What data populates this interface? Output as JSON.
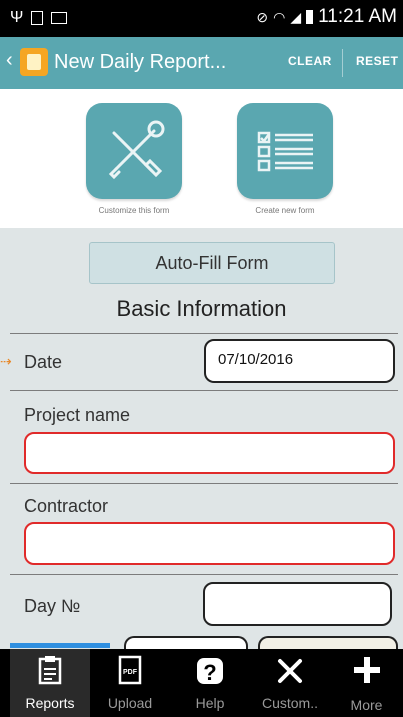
{
  "status": {
    "time": "11:21 AM"
  },
  "action_bar": {
    "title": "New Daily Report...",
    "clear": "CLEAR",
    "reset": "RESET"
  },
  "tiles": [
    {
      "caption": "Customize this form",
      "icon": "wrench-screwdriver-icon"
    },
    {
      "caption": "Create new form",
      "icon": "checklist-icon"
    }
  ],
  "autofill": {
    "label": "Auto-Fill Form"
  },
  "section": {
    "title": "Basic Information"
  },
  "fields": {
    "date": {
      "label": "Date",
      "value": "07/10/2016"
    },
    "project_name": {
      "label": "Project name",
      "value": ""
    },
    "contractor": {
      "label": "Contractor",
      "value": ""
    },
    "day_no": {
      "label": "Day №",
      "value": ""
    }
  },
  "tabs": [
    {
      "label": "Reports",
      "icon": "clipboard-icon",
      "active": true
    },
    {
      "label": "Upload",
      "icon": "pdf-icon",
      "active": false
    },
    {
      "label": "Help",
      "icon": "help-icon",
      "active": false
    },
    {
      "label": "Custom..",
      "icon": "tools-icon",
      "active": false
    },
    {
      "label": "More",
      "icon": "plus-icon",
      "active": false
    }
  ],
  "colors": {
    "accent": "#5aa7b0",
    "error": "#e02a2a",
    "active_tab": "#2f8fe0"
  }
}
